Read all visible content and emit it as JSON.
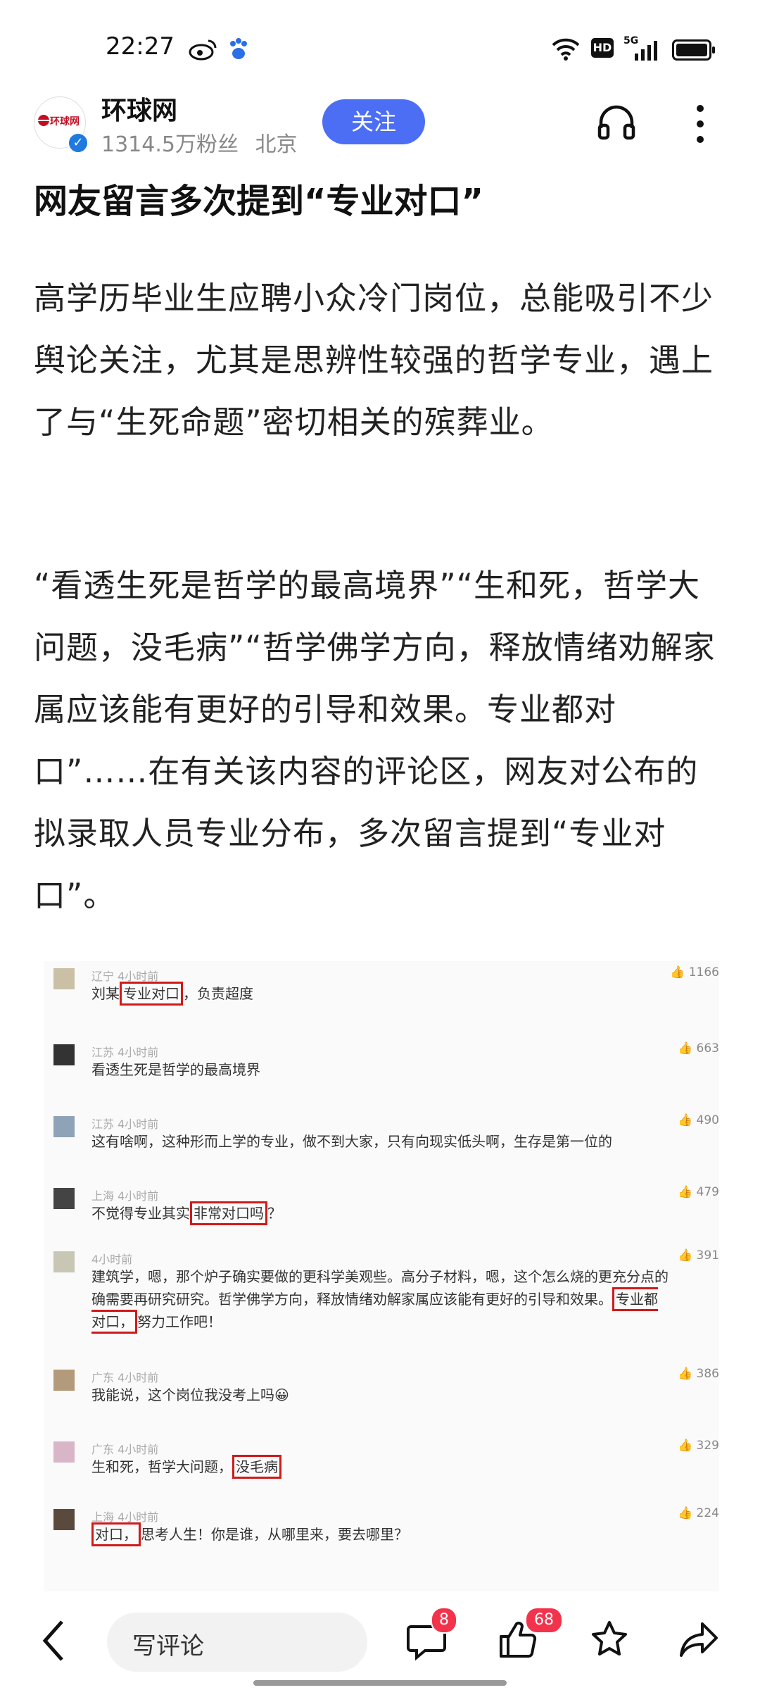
{
  "status_bar": {
    "time": "22:27",
    "hd_label": "HD",
    "signal_label": "5G"
  },
  "header": {
    "logo_text": "环球网",
    "account_name": "环球网",
    "followers": "1314.5万粉丝",
    "location": "北京",
    "follow_label": "关注"
  },
  "article": {
    "heading": "网友留言多次提到“专业对口”",
    "paragraphs": [
      "高学历毕业生应聘小众冷门岗位，总能吸引不少舆论关注，尤其是思辨性较强的哲学专业，遇上了与“生死命题”密切相关的殡葬业。",
      "“看透生死是哲学的最高境界”“生和死，哲学大问题，没毛病”“哲学佛学方向，释放情绪劝解家属应该能有更好的引导和效果。专业都对口”……在有关该内容的评论区，网友对公布的拟录取人员专业分布，多次留言提到“专业对口”。"
    ]
  },
  "comments": [
    {
      "meta": "辽宁 4小时前",
      "text_before": "刘某",
      "highlight": "专业对口",
      "text_after": "，负责超度",
      "likes": "1166"
    },
    {
      "meta": "江苏 4小时前",
      "text_before": "看透生死是哲学的最高境界",
      "highlight": "",
      "text_after": "",
      "likes": "663"
    },
    {
      "meta": "江苏 4小时前",
      "text_before": "这有啥啊，这种形而上学的专业，做不到大家，只有向现实低头啊，生存是第一位的",
      "highlight": "",
      "text_after": "",
      "likes": "490"
    },
    {
      "meta": "上海 4小时前",
      "text_before": "不觉得专业其实",
      "highlight": "非常对口吗",
      "text_after": "？",
      "likes": "479"
    },
    {
      "meta": "4小时前",
      "text_before": "建筑学，嗯，那个炉子确实要做的更科学美观些。高分子材料，嗯，这个怎么烧的更充分点的确需要再研究研究。哲学佛学方向，释放情绪劝解家属应该能有更好的引导和效果。",
      "highlight": "专业都对口，",
      "text_after": "努力工作吧！",
      "likes": "391"
    },
    {
      "meta": "广东 4小时前",
      "text_before": "我能说，这个岗位我没考上吗😀",
      "highlight": "",
      "text_after": "",
      "likes": "386"
    },
    {
      "meta": "广东 4小时前",
      "text_before": "生和死，哲学大问题，",
      "highlight": "没毛病",
      "text_after": "",
      "likes": "329"
    },
    {
      "meta": "上海 4小时前",
      "text_before": "",
      "highlight": "对口，",
      "text_after": "思考人生！你是谁，从哪里来，要去哪里？",
      "likes": "224"
    }
  ],
  "bottom_bar": {
    "comment_placeholder": "写评论",
    "comment_count": "8",
    "like_count": "68"
  },
  "colors": {
    "accent": "#4c6ef5",
    "badge": "#f2334b",
    "highlight_box": "#d01a1a"
  },
  "icons": [
    "weibo-icon",
    "baidu-paw-icon",
    "wifi-icon",
    "signal-icon",
    "battery-icon",
    "headphone-icon",
    "more-icon",
    "back-icon",
    "comment-icon",
    "like-icon",
    "favorite-icon",
    "share-icon"
  ]
}
